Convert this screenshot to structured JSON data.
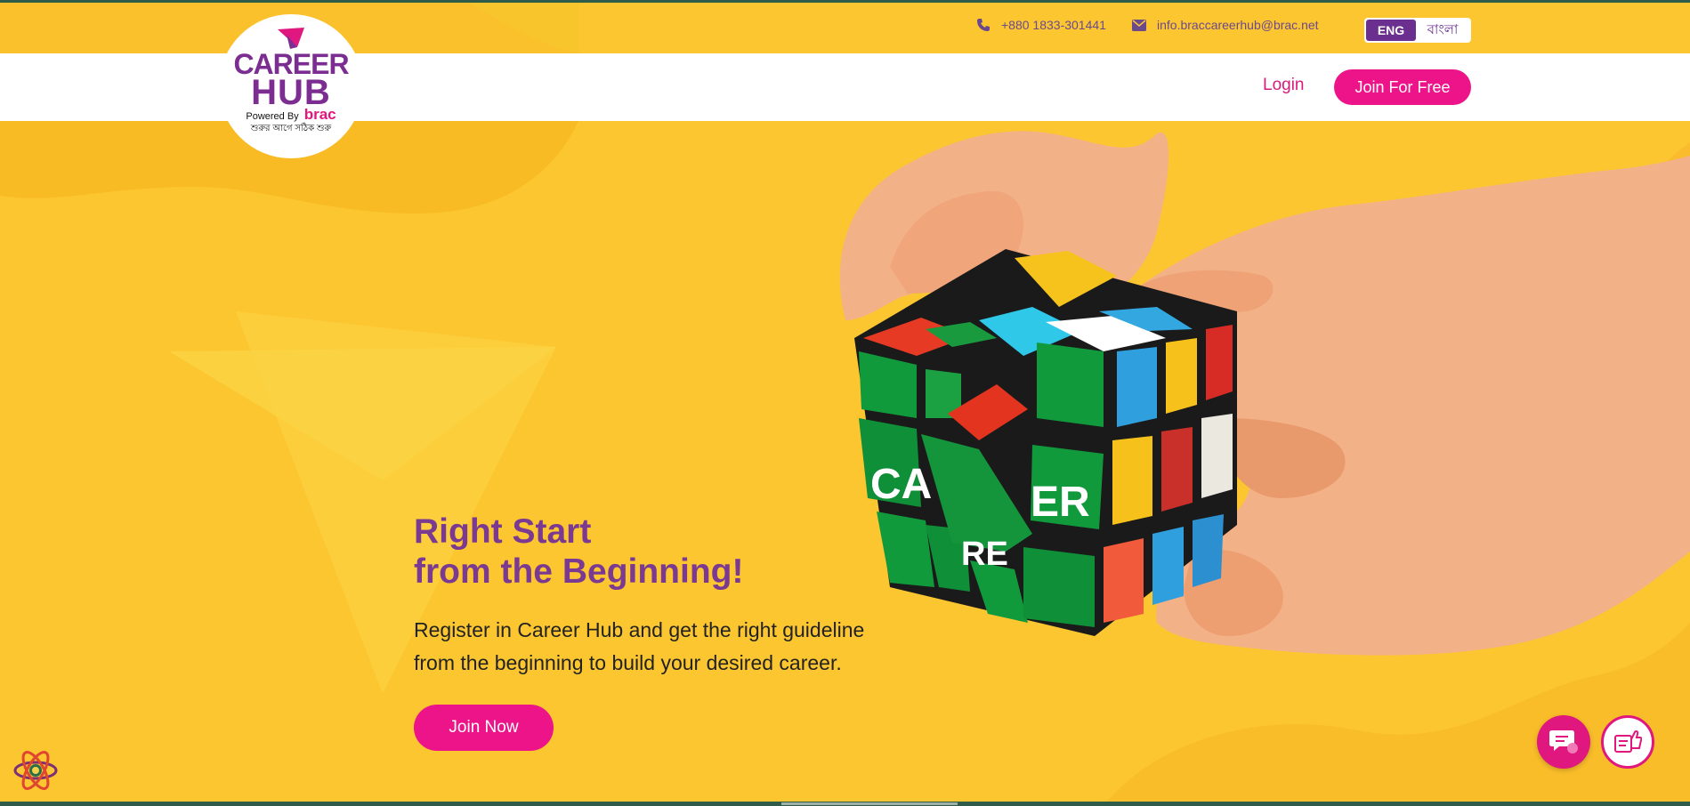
{
  "topbar": {
    "phone": "+880 1833-301441",
    "email": "info.braccareerhub@brac.net",
    "lang_en": "ENG",
    "lang_bn": "বাংলা"
  },
  "logo": {
    "career": "CAREER",
    "hub": "HUB",
    "powered": "Powered By",
    "brac": "brac",
    "tagline": "শুরুর আগে সঠিক শুরু"
  },
  "nav": {
    "login": "Login",
    "join_free": "Join For Free"
  },
  "hero": {
    "title_line1": "Right Start",
    "title_line2": "from the Beginning!",
    "desc_line1": "Register in Career Hub and get the right guideline",
    "desc_line2": "from the beginning to build your desired career.",
    "cta": "Join Now"
  },
  "cube": {
    "text1": "CA",
    "text2": "RE",
    "text3": "ER"
  },
  "colors": {
    "background": "#fcc630",
    "brand_purple": "#7a3a91",
    "brand_pink": "#ec1488"
  },
  "icons": {
    "phone": "phone-icon",
    "email": "envelope-icon",
    "chat": "chat-icon",
    "feedback": "feedback-icon",
    "react": "react-icon"
  }
}
